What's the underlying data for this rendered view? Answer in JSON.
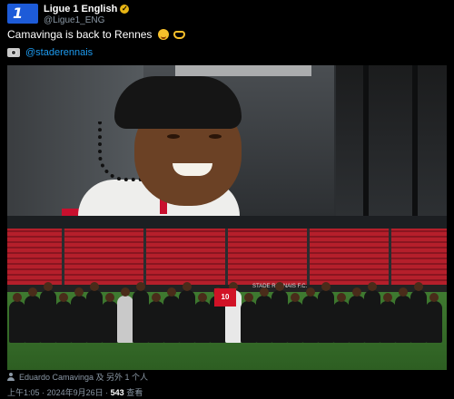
{
  "account": {
    "display_name": "Ligue 1 English",
    "handle": "@Ligue1_ENG",
    "logo_text": "1",
    "verified_icon": "verified-badge-icon"
  },
  "tweet": {
    "text": "Camavinga is back to Rennes",
    "emojis": [
      "smiling-face-emoji",
      "heart-hands-emoji"
    ],
    "mention": "@staderennais",
    "mention_icon": "camera-icon"
  },
  "media": {
    "image1": "player-portrait-photo",
    "image2": "team-group-photo",
    "jersey_number": "10",
    "stadium_board_text": "STADE RENNAIS F.C."
  },
  "footer": {
    "tagged": "Eduardo Camavinga 及 另外 1 个人",
    "time": "上午1:05",
    "date": "2024年9月26日",
    "separator": "·",
    "views_count": "543",
    "views_label": "查看"
  },
  "colors": {
    "background": "#000000",
    "accent_link": "#1d9bf0",
    "brand_blue": "#1d5bd8",
    "rennes_red": "#c8102e"
  }
}
